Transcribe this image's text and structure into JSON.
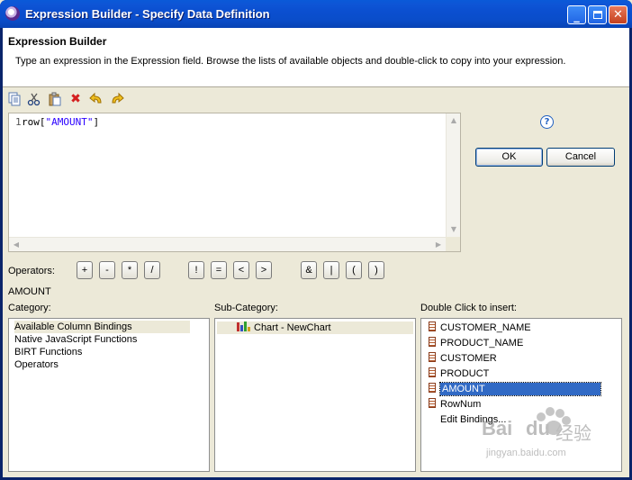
{
  "window": {
    "title": "Expression Builder - Specify Data Definition"
  },
  "header": {
    "title": "Expression Builder",
    "description": "Type an expression in the Expression field. Browse the lists of available objects and double-click to copy into your expression."
  },
  "editor": {
    "line_number": "1",
    "code_prefix": "row[",
    "code_string": "\"AMOUNT\"",
    "code_suffix": "]"
  },
  "buttons": {
    "ok": "OK",
    "cancel": "Cancel"
  },
  "operators": {
    "label": "Operators:",
    "items": [
      "+",
      "-",
      "*",
      "/",
      "!",
      "=",
      "<",
      ">",
      "&",
      "|",
      "(",
      ")"
    ]
  },
  "selected_value": "AMOUNT",
  "category": {
    "label": "Category:",
    "items": [
      "Available Column Bindings",
      "Native JavaScript Functions",
      "BIRT Functions",
      "Operators"
    ]
  },
  "subcategory": {
    "label": "Sub-Category:",
    "items": [
      "Chart - NewChart"
    ]
  },
  "insert": {
    "label": "Double Click to insert:",
    "items": [
      "CUSTOMER_NAME",
      "PRODUCT_NAME",
      "CUSTOMER",
      "PRODUCT",
      "AMOUNT",
      "RowNum",
      "Edit Bindings..."
    ]
  },
  "watermark": {
    "brand": "Bai",
    "brand2": "du",
    "cn": "经验",
    "url": "jingyan.baidu.com"
  },
  "colors": {
    "titlebar": "#0a4dca",
    "selection": "#316ac5",
    "string_literal": "#2a00ff",
    "delete_icon": "#d42020"
  }
}
